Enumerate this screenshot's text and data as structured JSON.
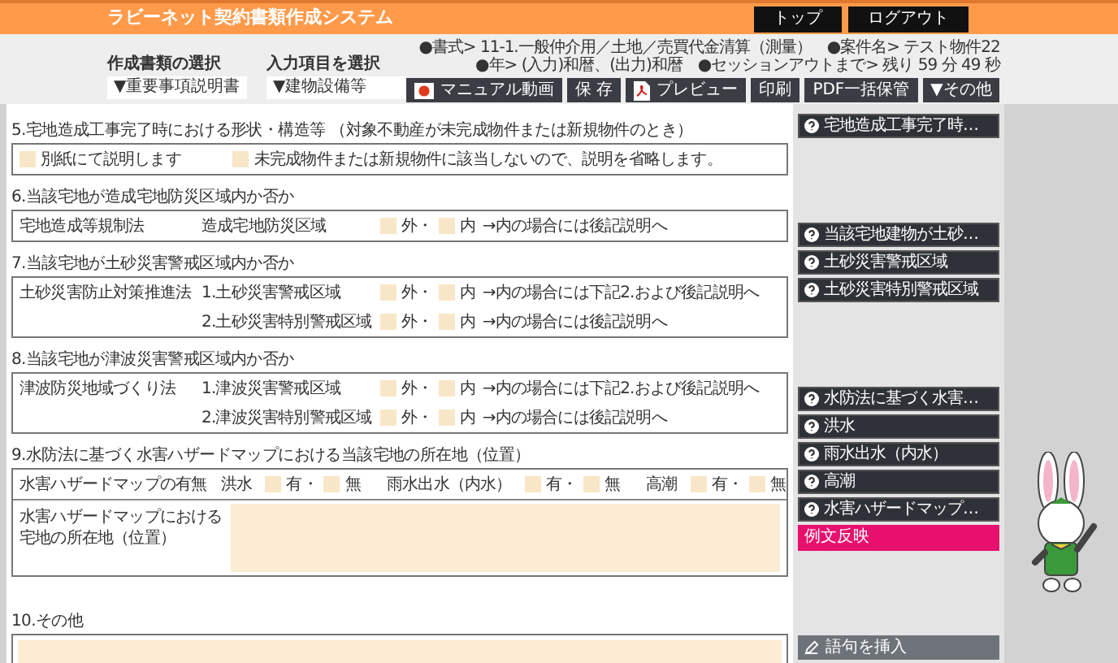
{
  "header": {
    "title": "ラビーネット契約書類作成システム",
    "buttons": [
      "トップ",
      "ログアウト"
    ]
  },
  "selectors": [
    {
      "label": "作成書類の選択",
      "value": "▼重要事項説明書"
    },
    {
      "label": "入力項目を選択",
      "value": "▼建物設備等"
    }
  ],
  "info_lines": [
    "●書式> 11-1.一般仲介用／土地／売買代金清算（測量）　●案件名> テスト物件22",
    "●年> (入力)和暦、(出力)和暦　●セッションアウトまで> 残り 59 分 49 秒"
  ],
  "toolbar": [
    {
      "kind": "video",
      "label": "マニュアル動画"
    },
    {
      "kind": "plain",
      "label": "保 存"
    },
    {
      "kind": "pdf",
      "label": "プレビュー"
    },
    {
      "kind": "plain",
      "label": "印刷"
    },
    {
      "kind": "plain",
      "label": "PDF一括保管"
    },
    {
      "kind": "plain",
      "label": "▼その他"
    }
  ],
  "sections": [
    {
      "title": "5.宅地造成工事完了時における形状・構造等 （対象不動産が未完成物件または新規物件のとき）",
      "rows": [
        {
          "kind": "options",
          "options": [
            {
              "label": "別紙にて説明します",
              "checked": false
            },
            {
              "label": "未完成物件または新規物件に該当しないので、説明を省略します。",
              "checked": false
            }
          ]
        }
      ]
    },
    {
      "title": "6.当該宅地が造成宅地防災区域内か否か",
      "rows": [
        {
          "kind": "check",
          "label": "宅地造成等規制法",
          "sublabel": "造成宅地防災区域",
          "options": [
            {
              "label": "外・",
              "checked": false
            },
            {
              "label": "内",
              "checked": false
            }
          ],
          "note": "→内の場合には後記説明へ"
        }
      ]
    },
    {
      "title": "7.当該宅地が土砂災害警戒区域内か否か",
      "rows": [
        {
          "kind": "check",
          "label": "土砂災害防止対策推進法",
          "sublabel": "1.土砂災害警戒区域",
          "options": [
            {
              "label": "外・",
              "checked": false
            },
            {
              "label": "内",
              "checked": false
            }
          ],
          "note": "→内の場合には下記2.および後記説明へ"
        },
        {
          "kind": "check",
          "sublabel": "2.土砂災害特別警戒区域",
          "options": [
            {
              "label": "外・",
              "checked": false
            },
            {
              "label": "内",
              "checked": false
            }
          ],
          "note": "→内の場合には後記説明へ"
        }
      ]
    },
    {
      "title": "8.当該宅地が津波災害警戒区域内か否か",
      "rows": [
        {
          "kind": "check",
          "label": "津波防災地域づくり法",
          "sublabel": "1.津波災害警戒区域",
          "options": [
            {
              "label": "外・",
              "checked": false
            },
            {
              "label": "内",
              "checked": false
            }
          ],
          "note": "→内の場合には下記2.および後記説明へ"
        },
        {
          "kind": "check",
          "sublabel": "2.津波災害特別警戒区域",
          "options": [
            {
              "label": "外・",
              "checked": false
            },
            {
              "label": "内",
              "checked": false
            }
          ],
          "note": "→内の場合には後記説明へ"
        }
      ]
    },
    {
      "title": "9.水防法に基づく水害ハザードマップにおける当該宅地の所在地（位置）",
      "rows": [
        {
          "kind": "groups",
          "label": "水害ハザードマップの有無",
          "groups": [
            {
              "label": "洪水",
              "options": [
                {
                  "label": "有・",
                  "checked": false
                },
                {
                  "label": "無",
                  "checked": false
                }
              ]
            },
            {
              "label": "雨水出水（内水）",
              "options": [
                {
                  "label": "有・",
                  "checked": false
                },
                {
                  "label": "無",
                  "checked": false
                }
              ]
            },
            {
              "label": "高潮",
              "options": [
                {
                  "label": "有・",
                  "checked": false
                },
                {
                  "label": "無",
                  "checked": false
                }
              ]
            }
          ]
        },
        {
          "kind": "textarea",
          "label_lines": [
            "水害ハザードマップにおける",
            "宅地の所在地（位置）"
          ]
        }
      ]
    },
    {
      "title": "10.その他",
      "rows": [
        {
          "kind": "textarea_cut"
        }
      ]
    }
  ],
  "side_buttons": [
    {
      "kind": "help",
      "label": "宅地造成工事完了時…"
    },
    {
      "kind": "spacer"
    },
    {
      "kind": "help",
      "label": "当該宅地建物が土砂…"
    },
    {
      "kind": "help",
      "label": "土砂災害警戒区域"
    },
    {
      "kind": "help",
      "label": "土砂災害特別警戒区域"
    },
    {
      "kind": "spacer"
    },
    {
      "kind": "help",
      "label": "水防法に基づく水害…"
    },
    {
      "kind": "help",
      "label": "洪水"
    },
    {
      "kind": "help",
      "label": "雨水出水（内水）"
    },
    {
      "kind": "help",
      "label": "高潮"
    },
    {
      "kind": "help",
      "label": "水害ハザードマップ…"
    },
    {
      "kind": "accent",
      "label": "例文反映"
    },
    {
      "kind": "spacer"
    },
    {
      "kind": "insert",
      "label": "語句を挿入"
    }
  ]
}
